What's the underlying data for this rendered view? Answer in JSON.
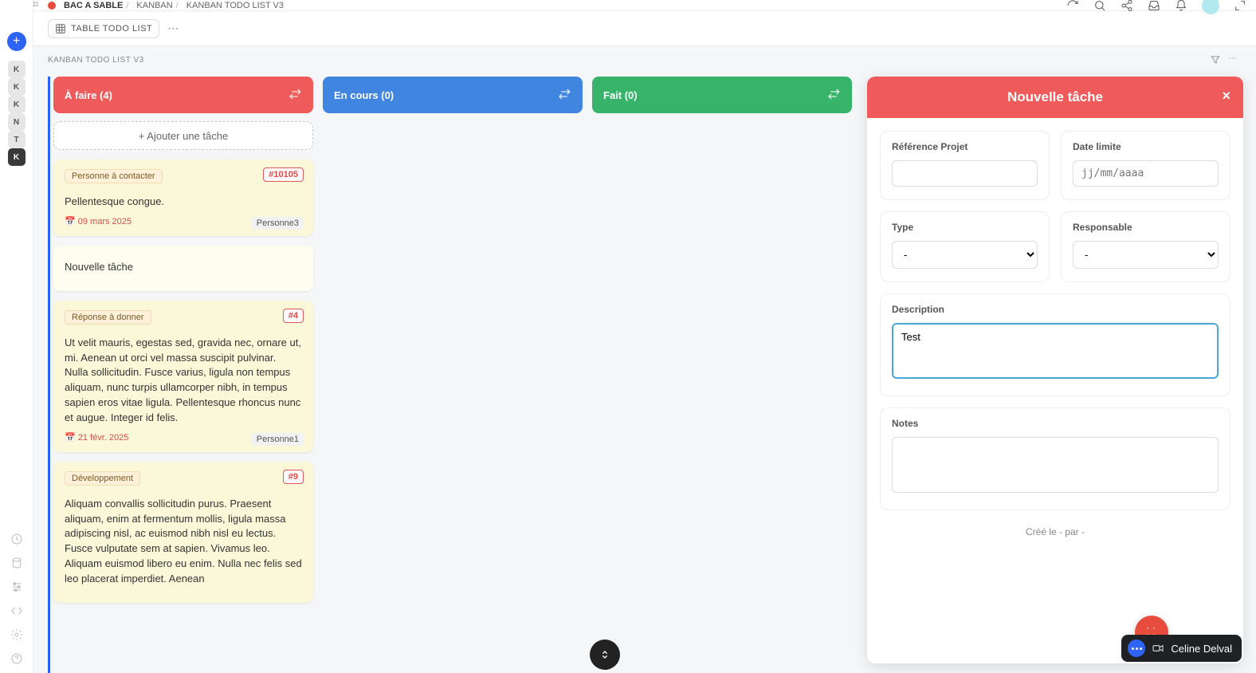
{
  "breadcrumb": {
    "workspace": "BAC A SABLE",
    "parent": "KANBAN",
    "current": "KANBAN TODO LIST V3"
  },
  "viewbar": {
    "table_view": "TABLE TODO LIST"
  },
  "leftrail": {
    "items": [
      {
        "letter": "K",
        "active": false
      },
      {
        "letter": "K",
        "active": false
      },
      {
        "letter": "K",
        "active": false
      },
      {
        "letter": "N",
        "active": false
      },
      {
        "letter": "T",
        "active": false
      },
      {
        "letter": "K",
        "active": true
      }
    ]
  },
  "board": {
    "title": "KANBAN TODO LIST V3",
    "columns": [
      {
        "key": "todo",
        "label": "À faire (4)",
        "color": "red"
      },
      {
        "key": "doing",
        "label": "En cours (0)",
        "color": "blue"
      },
      {
        "key": "done",
        "label": "Fait (0)",
        "color": "green"
      }
    ],
    "add_label": "+ Ajouter une tâche"
  },
  "cards": [
    {
      "ref": "#10105",
      "tag": "Personne à contacter",
      "body": "Pellentesque congue.",
      "date": "09 mars 2025",
      "assignee": "Personne3"
    },
    {
      "ref": "",
      "tag": "",
      "body": "Nouvelle tâche",
      "date": "",
      "assignee": ""
    },
    {
      "ref": "#4",
      "tag": "Réponse à donner",
      "body": "Ut velit mauris, egestas sed, gravida nec, ornare ut, mi. Aenean ut orci vel massa suscipit pulvinar. Nulla sollicitudin. Fusce varius, ligula non tempus aliquam, nunc turpis ullamcorper nibh, in tempus sapien eros vitae ligula. Pellentesque rhoncus nunc et augue. Integer id felis.",
      "date": "21 févr. 2025",
      "assignee": "Personne1"
    },
    {
      "ref": "#9",
      "tag": "Développement",
      "body": "Aliquam convallis sollicitudin purus. Praesent aliquam, enim at fermentum mollis, ligula massa adipiscing nisl, ac euismod nibh nisl eu lectus. Fusce vulputate sem at sapien. Vivamus leo. Aliquam euismod libero eu enim. Nulla nec felis sed leo placerat imperdiet. Aenean",
      "date": "",
      "assignee": ""
    }
  ],
  "panel": {
    "title": "Nouvelle tâche",
    "fields": {
      "ref_label": "Référence Projet",
      "date_label": "Date limite",
      "date_placeholder": "jj/mm/aaaa",
      "type_label": "Type",
      "type_value": "-",
      "resp_label": "Responsable",
      "resp_value": "-",
      "desc_label": "Description",
      "desc_value": "Test",
      "notes_label": "Notes"
    },
    "meta": "Créé le - par -"
  },
  "presence": {
    "name": "Celine Delval"
  }
}
